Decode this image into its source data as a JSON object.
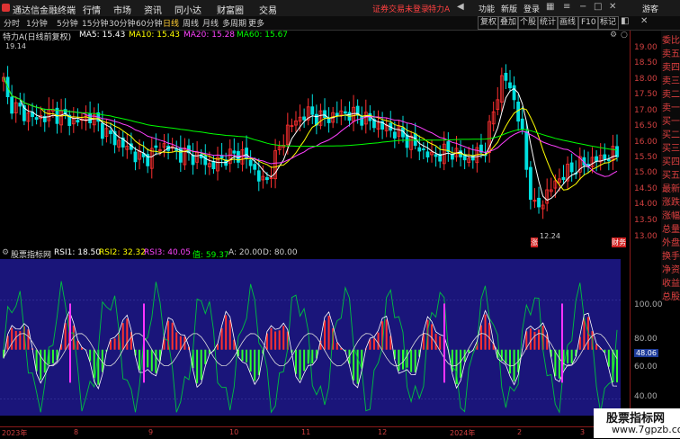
{
  "app": {
    "title": "通达信金融终端"
  },
  "menu": {
    "items": [
      "行情",
      "市场",
      "资讯",
      "同小达",
      "财富圈",
      "交易"
    ],
    "alert": "证券交易未登录",
    "stock_name": "特力A",
    "right": [
      "功能",
      "新版",
      "登录",
      "游客"
    ]
  },
  "toolbar": {
    "periods": [
      "分时",
      "1分钟",
      "5分钟",
      "15分钟",
      "30分钟",
      "60分钟",
      "日线",
      "周线",
      "月线",
      "多周期",
      "更多"
    ],
    "active_index": 6,
    "tools": [
      "复权",
      "叠加",
      "个股",
      "统计",
      "画线",
      "F10",
      "标记"
    ]
  },
  "info": {
    "title": "特力A(日线前复权)",
    "ma5": "MA5: 15.43",
    "ma10": "MA10: 15.43",
    "ma20": "MA20: 15.28",
    "ma60": "MA60: 15.67",
    "high_label": "19.14",
    "low_label": "12.24",
    "marker_s": "涨",
    "marker_r": "财务"
  },
  "price_axis": {
    "ticks": [
      "19.00",
      "18.50",
      "18.00",
      "17.50",
      "17.00",
      "16.50",
      "16.00",
      "15.50",
      "15.00",
      "14.50",
      "14.00",
      "13.50",
      "13.00"
    ]
  },
  "side_panel": [
    "委比",
    "卖五",
    "卖四",
    "卖三",
    "卖二",
    "卖一",
    "买一",
    "买二",
    "买三",
    "买四",
    "买五",
    "最新",
    "涨跌",
    "涨幅",
    "总量",
    "外盘",
    "换手",
    "净资",
    "收益",
    "总股"
  ],
  "indicator": {
    "name": "股票指标网",
    "rsi1": "RSI1: 18.50",
    "rsi2": "RSI2: 32.32",
    "rsi3": "RSI3: 40.05",
    "zhi": "值: 59.37",
    "a": "A: 20.00",
    "d": "D: 80.00",
    "ticks": [
      "100.00",
      "80.00",
      "60.00",
      "40.00",
      "20.00"
    ],
    "current": "48.06"
  },
  "date_axis": [
    "2023年",
    "8",
    "9",
    "10",
    "11",
    "12",
    "2024年",
    "2",
    "3"
  ],
  "watermark": {
    "line1": "股票指标网",
    "line2": "www.7gpzb.com"
  },
  "colors": {
    "up": "#ff3030",
    "down": "#00e0e0",
    "ma5": "#ffffff",
    "ma10": "#ffff00",
    "ma20": "#ff40ff",
    "ma60": "#00ff00",
    "panel": "#1a157a"
  }
}
